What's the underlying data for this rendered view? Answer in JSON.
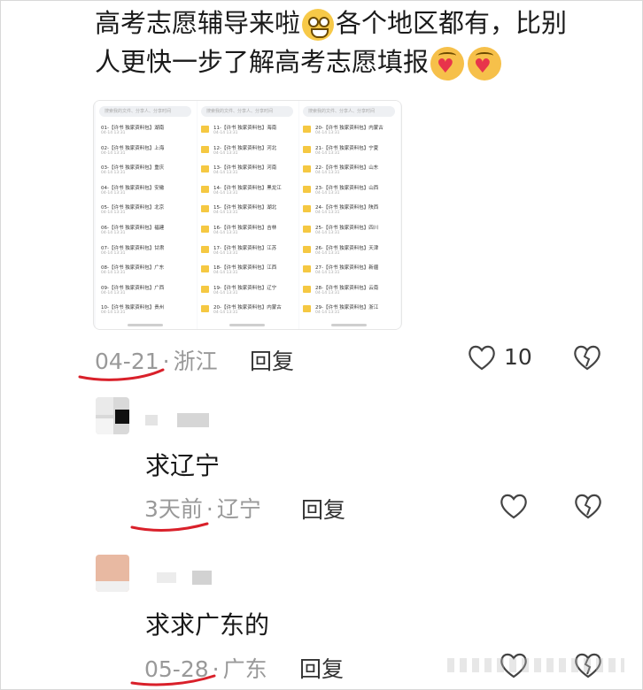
{
  "post": {
    "line1_part1": "高考志愿辅导来啦",
    "line1_emoji": "grin-face-emoji",
    "line1_part2": "各个地区都有，比别",
    "line2_text": "人更快一步了解高考志愿填报",
    "line2_emojis": [
      "love-face-emoji",
      "love-face-emoji"
    ],
    "date": "04-21",
    "region": "浙江",
    "reply_label": "回复",
    "likes": "10"
  },
  "thumbnail": {
    "search_placeholder": "搜索我的文件、分享人、分享时间",
    "col1": [
      {
        "name": "01-【许书 独家资料包】湖南",
        "date": "04-14 13:31"
      },
      {
        "name": "02-【许书 独家资料包】上海",
        "date": "04-14 13:31"
      },
      {
        "name": "03-【许书 独家资料包】重庆",
        "date": "04-14 13:31"
      },
      {
        "name": "04-【许书 独家资料包】安徽",
        "date": "04-14 13:31"
      },
      {
        "name": "05-【许书 独家资料包】北京",
        "date": "04-14 13:31"
      },
      {
        "name": "06-【许书 独家资料包】福建",
        "date": "04-14 13:31"
      },
      {
        "name": "07-【许书 独家资料包】甘肃",
        "date": "04-14 13:31"
      },
      {
        "name": "08-【许书 独家资料包】广东",
        "date": "04-14 13:31"
      },
      {
        "name": "09-【许书 独家资料包】广西",
        "date": "04-14 13:31"
      },
      {
        "name": "10-【许书 独家资料包】贵州",
        "date": "04-14 13:31"
      }
    ],
    "col2": [
      {
        "name": "11-【许书 独家资料包】海南",
        "date": "04-14 13:31"
      },
      {
        "name": "12-【许书 独家资料包】河北",
        "date": "04-14 13:31"
      },
      {
        "name": "13-【许书 独家资料包】河南",
        "date": "04-14 13:31"
      },
      {
        "name": "14-【许书 独家资料包】黑龙江",
        "date": "04-14 13:31"
      },
      {
        "name": "15-【许书 独家资料包】湖北",
        "date": "04-14 13:31"
      },
      {
        "name": "16-【许书 独家资料包】吉林",
        "date": "04-14 13:31"
      },
      {
        "name": "17-【许书 独家资料包】江苏",
        "date": "04-14 13:31"
      },
      {
        "name": "18-【许书 独家资料包】江西",
        "date": "04-14 13:31"
      },
      {
        "name": "19-【许书 独家资料包】辽宁",
        "date": "04-14 13:31"
      },
      {
        "name": "20-【许书 独家资料包】内蒙古",
        "date": "04-14 13:31"
      }
    ],
    "col3": [
      {
        "name": "20-【许书 独家资料包】内蒙古",
        "date": "04-14 13:31"
      },
      {
        "name": "21-【许书 独家资料包】宁夏",
        "date": "04-14 13:31"
      },
      {
        "name": "22-【许书 独家资料包】山东",
        "date": "04-14 13:31"
      },
      {
        "name": "23-【许书 独家资料包】山西",
        "date": "04-14 13:31"
      },
      {
        "name": "24-【许书 独家资料包】陕西",
        "date": "04-14 13:31"
      },
      {
        "name": "25-【许书 独家资料包】四川",
        "date": "04-14 13:31"
      },
      {
        "name": "26-【许书 独家资料包】天津",
        "date": "04-14 13:31"
      },
      {
        "name": "27-【许书 独家资料包】新疆",
        "date": "04-14 13:31"
      },
      {
        "name": "28-【许书 独家资料包】云南",
        "date": "04-14 13:31"
      },
      {
        "name": "29-【许书 独家资料包】浙江",
        "date": "04-14 13:31"
      }
    ]
  },
  "comments": [
    {
      "text": "求辽宁",
      "date": "3天前",
      "region": "辽宁",
      "reply_label": "回复"
    },
    {
      "text": "求求广东的",
      "date": "05-28",
      "region": "广东",
      "reply_label": "回复"
    }
  ],
  "colors": {
    "meta_gray": "#999999",
    "underline_red": "#d9202a",
    "folder_yellow": "#f5c842"
  },
  "icons": [
    "heart-outline-icon",
    "broken-heart-icon"
  ]
}
